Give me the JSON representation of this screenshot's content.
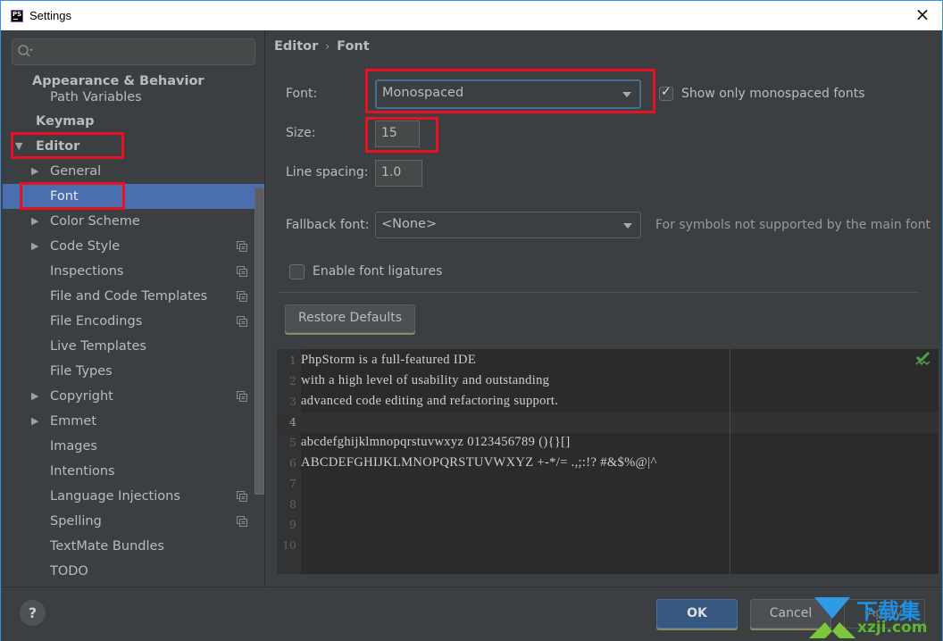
{
  "window": {
    "title": "Settings",
    "app_icon": "PS",
    "close_icon": "×"
  },
  "sidebar": {
    "search": {
      "value": "",
      "placeholder": ""
    },
    "items": [
      {
        "label": "Appearance & Behavior",
        "bold": true,
        "arrow": "",
        "copy": false
      },
      {
        "label": "Path Variables",
        "bold": false,
        "arrow": "",
        "copy": false
      },
      {
        "label": "Keymap",
        "bold": true,
        "arrow": "",
        "copy": false
      },
      {
        "label": "Editor",
        "bold": true,
        "arrow": "▼",
        "copy": false
      },
      {
        "label": "General",
        "bold": false,
        "arrow": "▶",
        "copy": false
      },
      {
        "label": "Font",
        "bold": false,
        "arrow": "",
        "copy": false,
        "selected": true
      },
      {
        "label": "Color Scheme",
        "bold": false,
        "arrow": "▶",
        "copy": false
      },
      {
        "label": "Code Style",
        "bold": false,
        "arrow": "▶",
        "copy": true
      },
      {
        "label": "Inspections",
        "bold": false,
        "arrow": "",
        "copy": true
      },
      {
        "label": "File and Code Templates",
        "bold": false,
        "arrow": "",
        "copy": true
      },
      {
        "label": "File Encodings",
        "bold": false,
        "arrow": "",
        "copy": true
      },
      {
        "label": "Live Templates",
        "bold": false,
        "arrow": "",
        "copy": false
      },
      {
        "label": "File Types",
        "bold": false,
        "arrow": "",
        "copy": false
      },
      {
        "label": "Copyright",
        "bold": false,
        "arrow": "▶",
        "copy": true
      },
      {
        "label": "Emmet",
        "bold": false,
        "arrow": "▶",
        "copy": false
      },
      {
        "label": "Images",
        "bold": false,
        "arrow": "",
        "copy": false
      },
      {
        "label": "Intentions",
        "bold": false,
        "arrow": "",
        "copy": false
      },
      {
        "label": "Language Injections",
        "bold": false,
        "arrow": "",
        "copy": true
      },
      {
        "label": "Spelling",
        "bold": false,
        "arrow": "",
        "copy": true
      },
      {
        "label": "TextMate Bundles",
        "bold": false,
        "arrow": "",
        "copy": false
      },
      {
        "label": "TODO",
        "bold": false,
        "arrow": "",
        "copy": false
      }
    ]
  },
  "content": {
    "breadcrumb": {
      "parent": "Editor",
      "separator": "›",
      "current": "Font"
    },
    "font": {
      "label": "Font:",
      "value": "Monospaced"
    },
    "show_only_monospaced": {
      "label": "Show only monospaced fonts",
      "checked": true
    },
    "size": {
      "label": "Size:",
      "value": "15"
    },
    "line_spacing": {
      "label": "Line spacing:",
      "value": "1.0"
    },
    "fallback_font": {
      "label": "Fallback font:",
      "value": "<None>",
      "hint": "For symbols not supported by the main font"
    },
    "ligatures": {
      "label": "Enable font ligatures",
      "checked": false
    },
    "restore_defaults": "Restore Defaults",
    "preview": {
      "lines": [
        {
          "num": "1",
          "text": "PhpStorm is a full-featured IDE"
        },
        {
          "num": "2",
          "text": "with a high level of usability and outstanding"
        },
        {
          "num": "3",
          "text": "advanced code editing and refactoring support."
        },
        {
          "num": "4",
          "text": ""
        },
        {
          "num": "5",
          "text": "abcdefghijklmnopqrstuvwxyz 0123456789 (){}[]"
        },
        {
          "num": "6",
          "text": "ABCDEFGHIJKLMNOPQRSTUVWXYZ +-*/= .,;:!? #&$%@|^"
        },
        {
          "num": "7",
          "text": ""
        },
        {
          "num": "8",
          "text": ""
        },
        {
          "num": "9",
          "text": ""
        },
        {
          "num": "10",
          "text": ""
        }
      ],
      "current_line": 4
    }
  },
  "footer": {
    "help": "?",
    "ok": "OK",
    "cancel": "Cancel",
    "apply": "Apply"
  },
  "watermark": {
    "text": "下载集",
    "url": "xzji.com"
  },
  "colors": {
    "selection": "#4b6eaf",
    "highlight": "#e81123",
    "ok_button": "#365880",
    "inspection_ok": "#4c9f4c"
  }
}
